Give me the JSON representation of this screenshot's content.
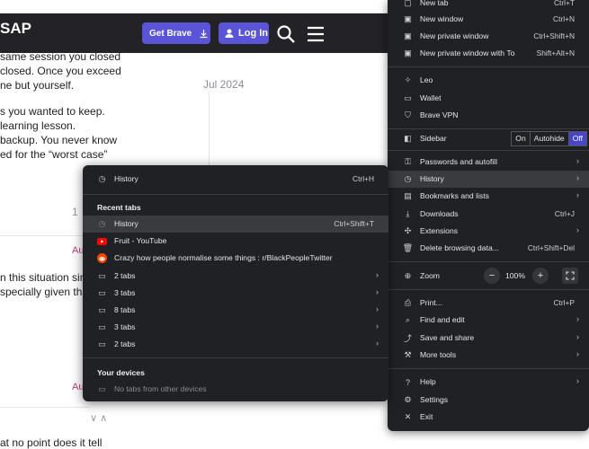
{
  "page": {
    "logo": "SAP",
    "get_brave": "Get Brave",
    "login": "Log In",
    "post_lines_1": [
      "same session you closed",
      "closed. Once you exceed",
      "ne but yourself."
    ],
    "post_lines_2": [
      "s you wanted to keep.",
      "learning lesson.",
      "backup. You never know",
      "ed for the “worst case”"
    ],
    "post_lines_3": [
      "n this situation sin",
      "specially given tha"
    ],
    "timeline_date": "Jul 2024",
    "page_num": "1",
    "date_link_1": "Au",
    "date_link_2": "Au",
    "bottom_line": "at no point does it tell",
    "votes": "∨ ∧"
  },
  "main_menu": {
    "items": [
      {
        "label": "New tab",
        "shortcut": "Ctrl+T",
        "icon": "new-tab-icon"
      },
      {
        "label": "New window",
        "shortcut": "Ctrl+N",
        "icon": "new-window-icon"
      },
      {
        "label": "New private window",
        "shortcut": "Ctrl+Shift+N",
        "icon": "private-window-icon"
      },
      {
        "label": "New private window with Tor",
        "shortcut": "Shift+Alt+N",
        "icon": "tor-window-icon"
      },
      {
        "label": "Leo",
        "icon": "leo-icon"
      },
      {
        "label": "Wallet",
        "icon": "wallet-icon"
      },
      {
        "label": "Brave VPN",
        "icon": "vpn-shield-icon"
      },
      {
        "label": "Sidebar",
        "icon": "sidebar-icon"
      },
      {
        "label": "Passwords and autofill",
        "icon": "key-icon"
      },
      {
        "label": "History",
        "icon": "history-icon"
      },
      {
        "label": "Bookmarks and lists",
        "icon": "bookmark-icon"
      },
      {
        "label": "Downloads",
        "shortcut": "Ctrl+J",
        "icon": "download-icon"
      },
      {
        "label": "Extensions",
        "icon": "extensions-icon"
      },
      {
        "label": "Delete browsing data...",
        "shortcut": "Ctrl+Shift+Del",
        "icon": "trash-icon"
      },
      {
        "label": "Zoom",
        "icon": "zoom-icon"
      },
      {
        "label": "Print...",
        "shortcut": "Ctrl+P",
        "icon": "print-icon"
      },
      {
        "label": "Find and edit",
        "icon": "find-icon"
      },
      {
        "label": "Save and share",
        "icon": "share-icon"
      },
      {
        "label": "More tools",
        "icon": "tools-icon"
      },
      {
        "label": "Help",
        "icon": "help-icon"
      },
      {
        "label": "Settings",
        "icon": "settings-gear-icon"
      },
      {
        "label": "Exit",
        "icon": "exit-x-icon"
      }
    ],
    "sidebar_options": [
      "On",
      "Autohide",
      "Off"
    ],
    "sidebar_selected": "Off",
    "zoom_minus": "−",
    "zoom_value": "100%",
    "zoom_plus": "+"
  },
  "history_menu": {
    "history_label": "History",
    "history_shortcut": "Ctrl+H",
    "recent_heading": "Recent tabs",
    "recent": [
      {
        "label": "History",
        "shortcut": "Ctrl+Shift+T",
        "icon": "history-icon"
      },
      {
        "label": "Fruit - YouTube",
        "icon": "youtube-icon"
      },
      {
        "label": "Crazy how people normalise some things : r/BlackPeopleTwitter",
        "icon": "reddit-icon"
      },
      {
        "label": "2 tabs",
        "icon": "window-icon"
      },
      {
        "label": "3 tabs",
        "icon": "window-icon"
      },
      {
        "label": "8 tabs",
        "icon": "window-icon"
      },
      {
        "label": "3 tabs",
        "icon": "window-icon"
      },
      {
        "label": "2 tabs",
        "icon": "window-icon"
      }
    ],
    "devices_heading": "Your devices",
    "no_devices": "No tabs from other devices"
  },
  "colors": {
    "menu_bg": "#202124",
    "highlight": "#3a3b3f",
    "accent": "#5a55d6",
    "header_bg": "#222227"
  }
}
